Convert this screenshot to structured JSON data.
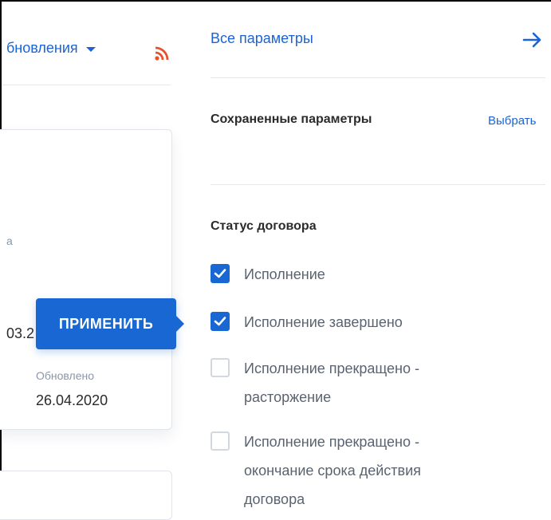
{
  "left": {
    "sort_label": "бновления",
    "frag_a": "а",
    "frag_date": "03.2",
    "updated_label": "Обновлено",
    "updated_date": "26.04.2020",
    "apply_label": "ПРИМЕНИТЬ"
  },
  "panel": {
    "all_params": "Все параметры",
    "saved_title": "Сохраненные параметры",
    "choose": "Выбрать",
    "status_title": "Статус договора",
    "options": [
      {
        "label": "Исполнение",
        "checked": true
      },
      {
        "label": "Исполнение завершено",
        "checked": true
      },
      {
        "label": "Исполнение прекращено - расторжение",
        "checked": false
      },
      {
        "label": "Исполнение прекращено - окончание срока действия договора",
        "checked": false
      }
    ]
  },
  "colors": {
    "accent": "#1967d2",
    "rss": "#e5532d",
    "muted": "#8a96a8"
  },
  "icons": [
    "chevron-down-icon",
    "rss-icon",
    "arrow-right-icon",
    "checkmark-icon"
  ]
}
